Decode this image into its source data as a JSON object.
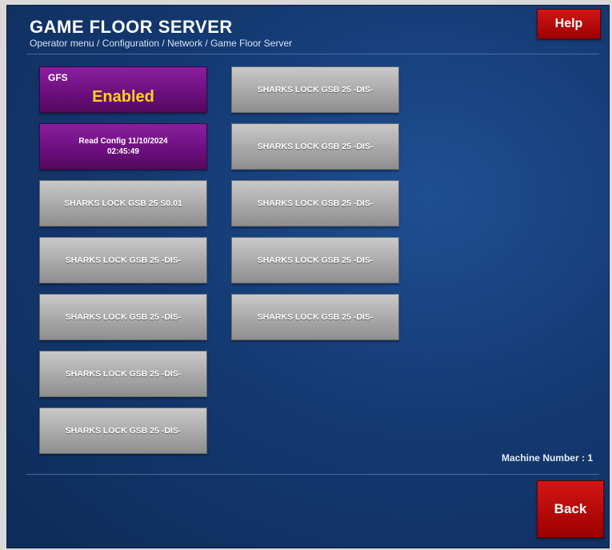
{
  "header": {
    "title": "GAME FLOOR SERVER",
    "breadcrumb": "Operator menu / Configuration / Network / Game Floor Server"
  },
  "buttons": {
    "help": "Help",
    "back": "Back"
  },
  "gfs": {
    "label": "GFS",
    "status": "Enabled"
  },
  "read_config": {
    "line1": "Read Config 11/10/2024",
    "line2": "02:45:49"
  },
  "machines_left": [
    "SHARKS LOCK GSB 25 S0.01",
    "SHARKS LOCK GSB 25 -DIS-",
    "SHARKS LOCK GSB 25 -DIS-",
    "SHARKS LOCK GSB 25 -DIS-",
    "SHARKS LOCK GSB 25 -DIS-"
  ],
  "machines_right": [
    "SHARKS LOCK GSB 25 -DIS-",
    "SHARKS LOCK GSB 25 -DIS-",
    "SHARKS LOCK GSB 25 -DIS-",
    "SHARKS LOCK GSB 25 -DIS-",
    "SHARKS LOCK GSB 25 -DIS-"
  ],
  "footer": {
    "machine_number": "Machine Number : 1"
  },
  "colors": {
    "background": "#143a73",
    "accent_red": "#c00000",
    "gfs_purple": "#7a1a8e",
    "status_yellow": "#ffd21f",
    "tile_gray": "#a8a8a8"
  }
}
